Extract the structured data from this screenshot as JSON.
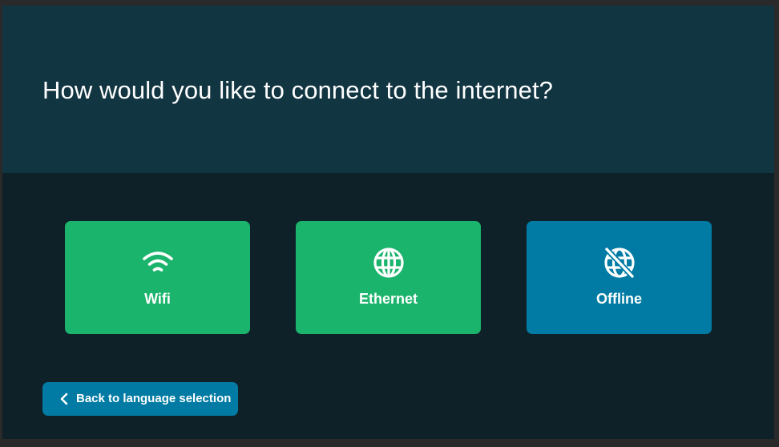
{
  "header": {
    "title": "How would you like to connect to the internet?"
  },
  "options": [
    {
      "label": "Wifi",
      "icon": "wifi-icon",
      "color": "#1bb46c"
    },
    {
      "label": "Ethernet",
      "icon": "globe-icon",
      "color": "#1bb46c"
    },
    {
      "label": "Offline",
      "icon": "globe-slash-icon",
      "color": "#017ba3"
    }
  ],
  "back": {
    "label": "Back to language selection",
    "icon": "chevron-left-icon"
  },
  "colors": {
    "header_bg": "#123542",
    "body_bg": "#0e2129",
    "accent_green": "#1bb46c",
    "accent_blue": "#017ba3"
  }
}
